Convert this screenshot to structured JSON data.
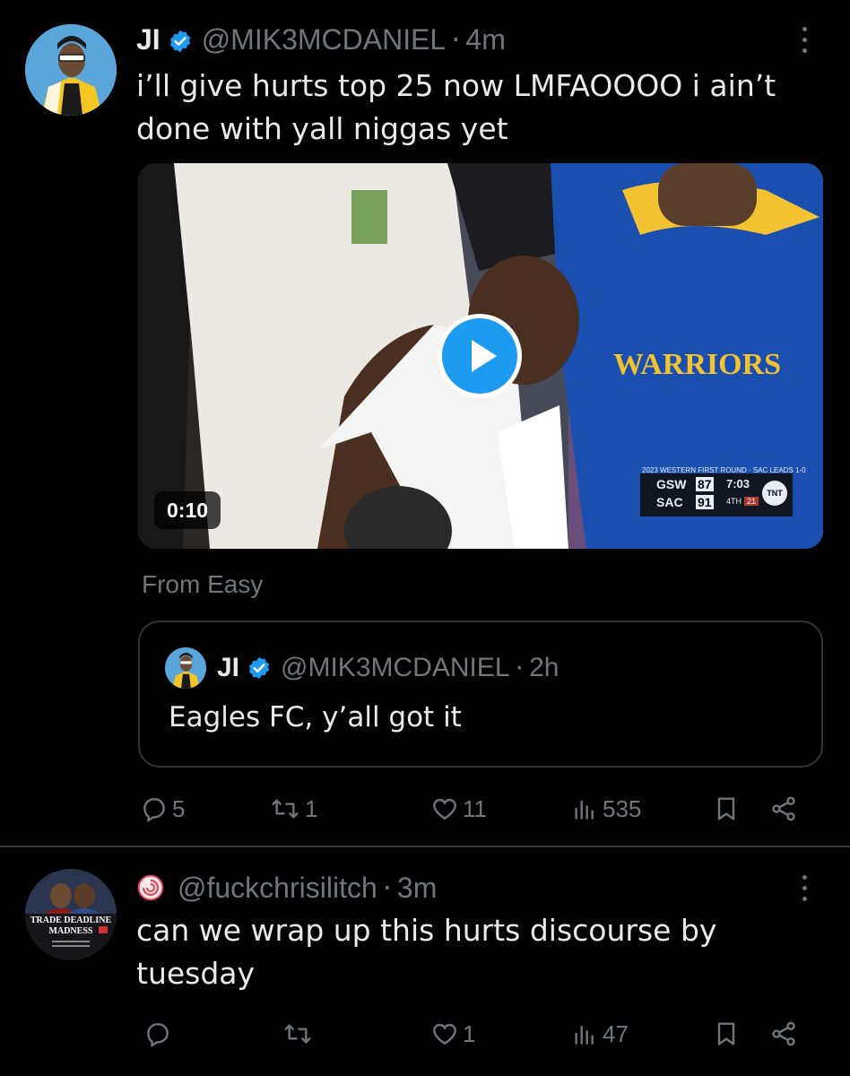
{
  "tweets": [
    {
      "name": "JI",
      "handle": "@MIK3MCDANIEL",
      "time": "4m",
      "text": "i’ll give hurts top 25 now LMFAOOOO i ain’t done with yall niggas yet",
      "video": {
        "duration": "0:10",
        "jersey_text": "WARRIORS",
        "scoreboard": {
          "banner": "2023 WESTERN FIRST ROUND · SAC LEADS 1-0",
          "team1": "GSW",
          "score1": "87",
          "team2": "SAC",
          "score2": "91",
          "clock": "7:03",
          "quarter": "4TH",
          "shot_clock": "21",
          "network": "TNT"
        }
      },
      "source": "From Easy",
      "quote": {
        "name": "JI",
        "handle": "@MIK3MCDANIEL",
        "time": "2h",
        "text": "Eagles FC, y’all got it"
      },
      "actions": {
        "replies": "5",
        "reposts": "1",
        "likes": "11",
        "views": "535"
      }
    },
    {
      "name": "",
      "handle": "@fuckchrisilitch",
      "time": "3m",
      "text": "can we wrap up this hurts discourse by tuesday",
      "avatar_text": "TRADE DEADLINE MADNESS",
      "actions": {
        "replies": "",
        "reposts": "",
        "likes": "1",
        "views": "47"
      }
    }
  ],
  "colors": {
    "background": "#000000",
    "text": "#e7e9ea",
    "secondary": "#71767b",
    "border": "#2f3336",
    "accent": "#1d9bf0"
  },
  "icons": [
    "verified-badge-icon",
    "more-icon",
    "reply-icon",
    "repost-icon",
    "like-icon",
    "views-icon",
    "bookmark-icon",
    "share-icon",
    "play-icon"
  ]
}
